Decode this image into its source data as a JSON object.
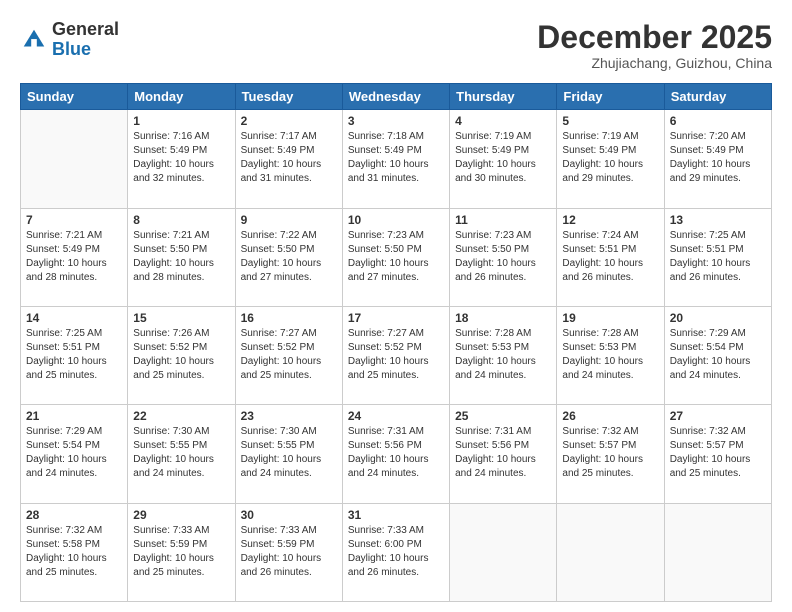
{
  "header": {
    "logo_general": "General",
    "logo_blue": "Blue",
    "month_title": "December 2025",
    "location": "Zhujiachang, Guizhou, China"
  },
  "days_of_week": [
    "Sunday",
    "Monday",
    "Tuesday",
    "Wednesday",
    "Thursday",
    "Friday",
    "Saturday"
  ],
  "weeks": [
    [
      {
        "num": "",
        "info": ""
      },
      {
        "num": "1",
        "info": "Sunrise: 7:16 AM\nSunset: 5:49 PM\nDaylight: 10 hours\nand 32 minutes."
      },
      {
        "num": "2",
        "info": "Sunrise: 7:17 AM\nSunset: 5:49 PM\nDaylight: 10 hours\nand 31 minutes."
      },
      {
        "num": "3",
        "info": "Sunrise: 7:18 AM\nSunset: 5:49 PM\nDaylight: 10 hours\nand 31 minutes."
      },
      {
        "num": "4",
        "info": "Sunrise: 7:19 AM\nSunset: 5:49 PM\nDaylight: 10 hours\nand 30 minutes."
      },
      {
        "num": "5",
        "info": "Sunrise: 7:19 AM\nSunset: 5:49 PM\nDaylight: 10 hours\nand 29 minutes."
      },
      {
        "num": "6",
        "info": "Sunrise: 7:20 AM\nSunset: 5:49 PM\nDaylight: 10 hours\nand 29 minutes."
      }
    ],
    [
      {
        "num": "7",
        "info": "Sunrise: 7:21 AM\nSunset: 5:49 PM\nDaylight: 10 hours\nand 28 minutes."
      },
      {
        "num": "8",
        "info": "Sunrise: 7:21 AM\nSunset: 5:50 PM\nDaylight: 10 hours\nand 28 minutes."
      },
      {
        "num": "9",
        "info": "Sunrise: 7:22 AM\nSunset: 5:50 PM\nDaylight: 10 hours\nand 27 minutes."
      },
      {
        "num": "10",
        "info": "Sunrise: 7:23 AM\nSunset: 5:50 PM\nDaylight: 10 hours\nand 27 minutes."
      },
      {
        "num": "11",
        "info": "Sunrise: 7:23 AM\nSunset: 5:50 PM\nDaylight: 10 hours\nand 26 minutes."
      },
      {
        "num": "12",
        "info": "Sunrise: 7:24 AM\nSunset: 5:51 PM\nDaylight: 10 hours\nand 26 minutes."
      },
      {
        "num": "13",
        "info": "Sunrise: 7:25 AM\nSunset: 5:51 PM\nDaylight: 10 hours\nand 26 minutes."
      }
    ],
    [
      {
        "num": "14",
        "info": "Sunrise: 7:25 AM\nSunset: 5:51 PM\nDaylight: 10 hours\nand 25 minutes."
      },
      {
        "num": "15",
        "info": "Sunrise: 7:26 AM\nSunset: 5:52 PM\nDaylight: 10 hours\nand 25 minutes."
      },
      {
        "num": "16",
        "info": "Sunrise: 7:27 AM\nSunset: 5:52 PM\nDaylight: 10 hours\nand 25 minutes."
      },
      {
        "num": "17",
        "info": "Sunrise: 7:27 AM\nSunset: 5:52 PM\nDaylight: 10 hours\nand 25 minutes."
      },
      {
        "num": "18",
        "info": "Sunrise: 7:28 AM\nSunset: 5:53 PM\nDaylight: 10 hours\nand 24 minutes."
      },
      {
        "num": "19",
        "info": "Sunrise: 7:28 AM\nSunset: 5:53 PM\nDaylight: 10 hours\nand 24 minutes."
      },
      {
        "num": "20",
        "info": "Sunrise: 7:29 AM\nSunset: 5:54 PM\nDaylight: 10 hours\nand 24 minutes."
      }
    ],
    [
      {
        "num": "21",
        "info": "Sunrise: 7:29 AM\nSunset: 5:54 PM\nDaylight: 10 hours\nand 24 minutes."
      },
      {
        "num": "22",
        "info": "Sunrise: 7:30 AM\nSunset: 5:55 PM\nDaylight: 10 hours\nand 24 minutes."
      },
      {
        "num": "23",
        "info": "Sunrise: 7:30 AM\nSunset: 5:55 PM\nDaylight: 10 hours\nand 24 minutes."
      },
      {
        "num": "24",
        "info": "Sunrise: 7:31 AM\nSunset: 5:56 PM\nDaylight: 10 hours\nand 24 minutes."
      },
      {
        "num": "25",
        "info": "Sunrise: 7:31 AM\nSunset: 5:56 PM\nDaylight: 10 hours\nand 24 minutes."
      },
      {
        "num": "26",
        "info": "Sunrise: 7:32 AM\nSunset: 5:57 PM\nDaylight: 10 hours\nand 25 minutes."
      },
      {
        "num": "27",
        "info": "Sunrise: 7:32 AM\nSunset: 5:57 PM\nDaylight: 10 hours\nand 25 minutes."
      }
    ],
    [
      {
        "num": "28",
        "info": "Sunrise: 7:32 AM\nSunset: 5:58 PM\nDaylight: 10 hours\nand 25 minutes."
      },
      {
        "num": "29",
        "info": "Sunrise: 7:33 AM\nSunset: 5:59 PM\nDaylight: 10 hours\nand 25 minutes."
      },
      {
        "num": "30",
        "info": "Sunrise: 7:33 AM\nSunset: 5:59 PM\nDaylight: 10 hours\nand 26 minutes."
      },
      {
        "num": "31",
        "info": "Sunrise: 7:33 AM\nSunset: 6:00 PM\nDaylight: 10 hours\nand 26 minutes."
      },
      {
        "num": "",
        "info": ""
      },
      {
        "num": "",
        "info": ""
      },
      {
        "num": "",
        "info": ""
      }
    ]
  ]
}
